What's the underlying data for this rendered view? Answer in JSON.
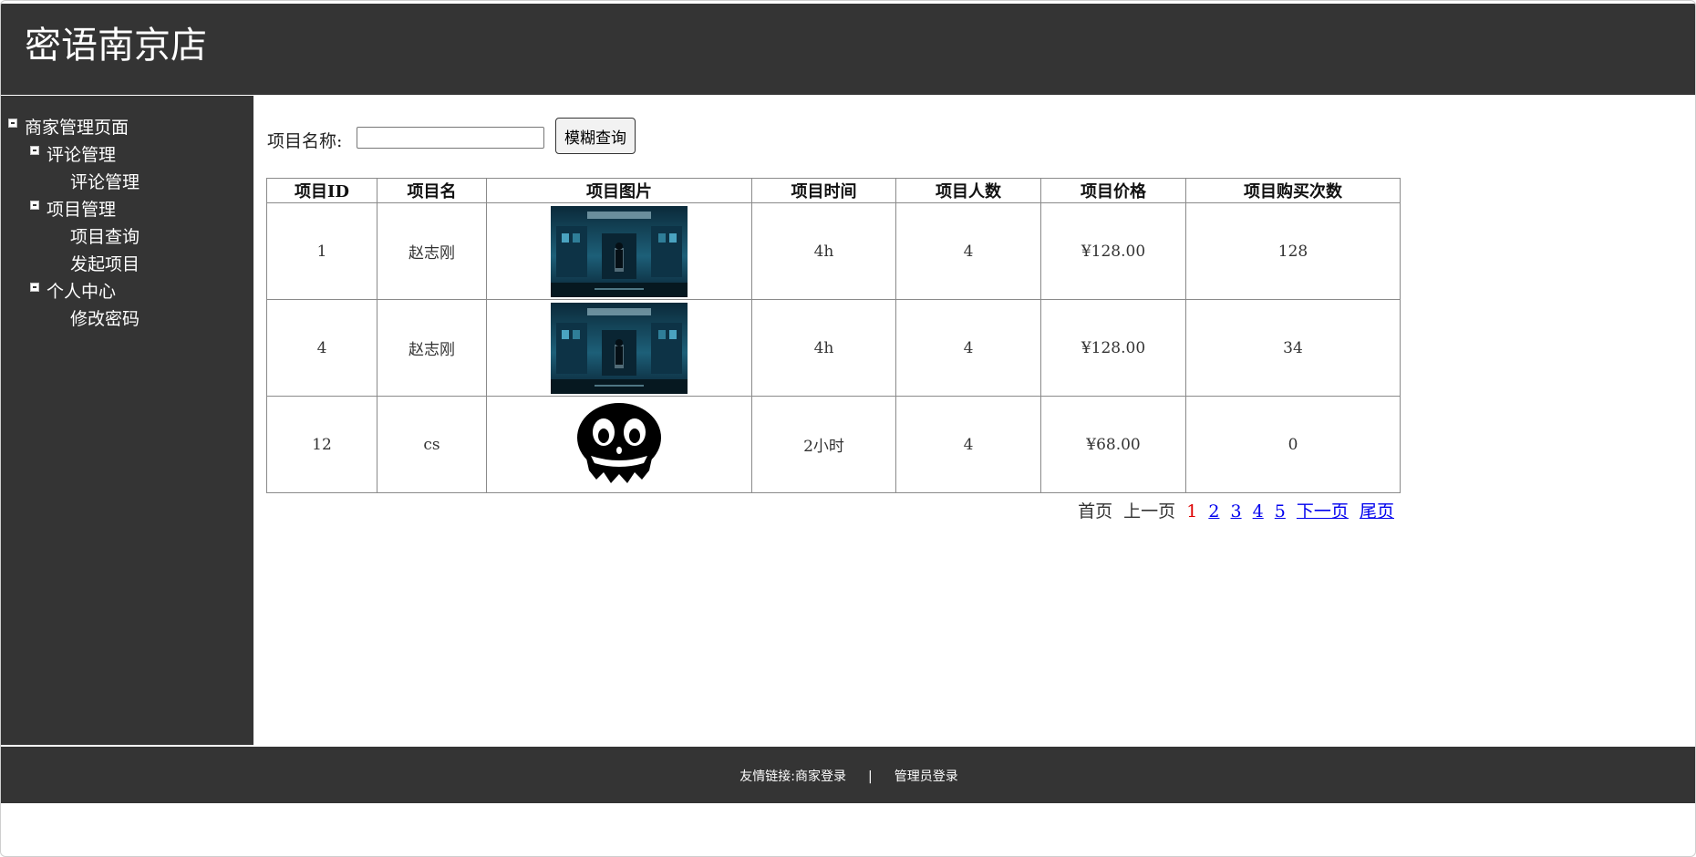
{
  "header": {
    "title": "密语南京店"
  },
  "sidebar": {
    "root": "商家管理页面",
    "groups": [
      {
        "label": "评论管理",
        "items": [
          "评论管理"
        ]
      },
      {
        "label": "项目管理",
        "items": [
          "项目查询",
          "发起项目"
        ]
      },
      {
        "label": "个人中心",
        "items": [
          "修改密码"
        ]
      }
    ]
  },
  "search": {
    "label": "项目名称:",
    "value": "",
    "button": "模糊查询"
  },
  "table": {
    "columns": [
      "项目ID",
      "项目名",
      "项目图片",
      "项目时间",
      "项目人数",
      "项目价格",
      "项目购买次数"
    ],
    "rows": [
      {
        "id": "1",
        "name": "赵志刚",
        "image": "dark-corridor-poster",
        "time": "4h",
        "people": "4",
        "price": "¥128.00",
        "purchases": "128"
      },
      {
        "id": "4",
        "name": "赵志刚",
        "image": "dark-corridor-poster",
        "time": "4h",
        "people": "4",
        "price": "¥128.00",
        "purchases": "34"
      },
      {
        "id": "12",
        "name": "cs",
        "image": "skull-grin-icon",
        "time": "2小时",
        "people": "4",
        "price": "¥68.00",
        "purchases": "0"
      }
    ]
  },
  "pager": {
    "first": "首页",
    "prev": "上一页",
    "pages": [
      "1",
      "2",
      "3",
      "4",
      "5"
    ],
    "current": "1",
    "next": "下一页",
    "last": "尾页"
  },
  "footer": {
    "links_label": "友情链接:商家登录",
    "separator": "|",
    "admin_login": "管理员登录"
  },
  "colors": {
    "dark_bg": "#343434",
    "link": "#0000ee",
    "current_page": "#dd0000"
  }
}
